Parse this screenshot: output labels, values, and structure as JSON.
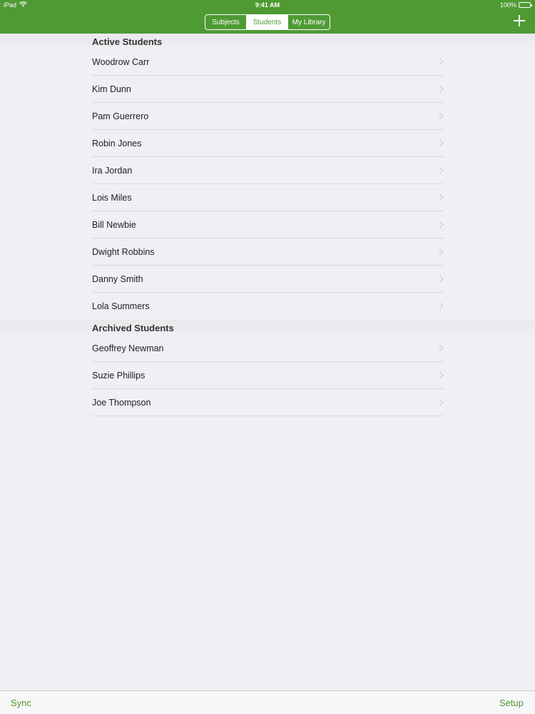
{
  "status_bar": {
    "device": "iPad",
    "time": "9:41 AM",
    "battery": "100%",
    "battery_level": 1.0
  },
  "nav": {
    "segments": [
      {
        "label": "Subjects",
        "selected": false
      },
      {
        "label": "Students",
        "selected": true
      },
      {
        "label": "My Library",
        "selected": false
      }
    ],
    "add_icon": "plus-icon"
  },
  "sections": {
    "active": {
      "title": "Active Students",
      "students": [
        "Woodrow Carr",
        "Kim Dunn",
        "Pam Guerrero",
        "Robin Jones",
        "Ira Jordan",
        "Lois Miles",
        "Bill Newbie",
        "Dwight Robbins",
        "Danny Smith",
        "Lola Summers"
      ]
    },
    "archived": {
      "title": "Archived Students",
      "students": [
        "Geoffrey Newman",
        "Suzie Phillips",
        "Joe Thompson"
      ]
    }
  },
  "toolbar": {
    "sync_label": "Sync",
    "setup_label": "Setup"
  },
  "colors": {
    "accent": "#4f9a33",
    "background": "#efeff4",
    "chevron": "#c7c7cc"
  }
}
